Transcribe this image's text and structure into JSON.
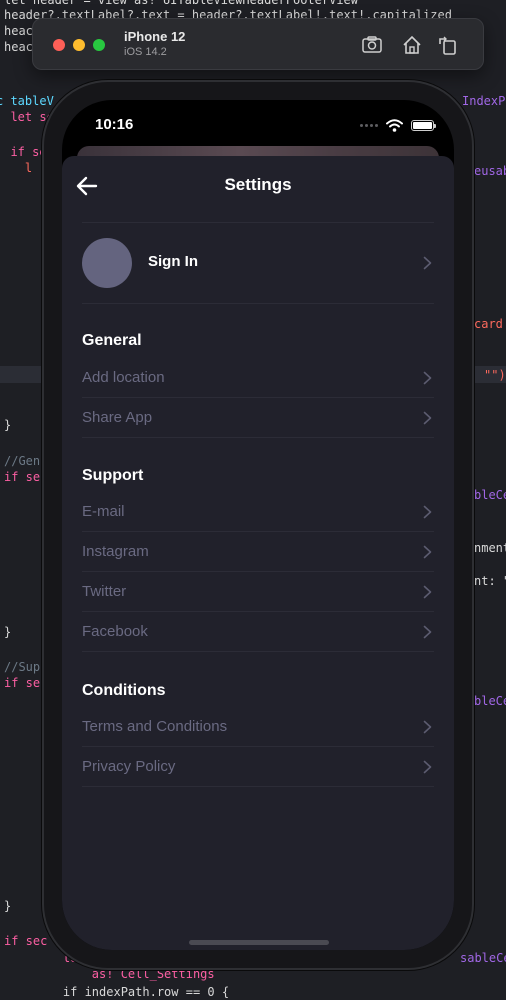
{
  "code": {
    "lines": [
      {
        "text": "let header = view as! UITableViewHeaderFooterView"
      },
      {
        "text": "header?.textLabel?.text = header?.textLabel!.text!.capitalized"
      },
      {
        "text": "heac"
      },
      {
        "text": "heac"
      },
      {
        "text": "c tableV"
      },
      {
        "text": "  let se"
      },
      {
        "text": "  if se"
      },
      {
        "text": "    l"
      },
      {
        "text": "}"
      },
      {
        "text": "//Gen"
      },
      {
        "text": "if se"
      },
      {
        "text": "}"
      },
      {
        "text": "//Sup"
      },
      {
        "text": "if se"
      },
      {
        "text": "}"
      },
      {
        "text": "if sec"
      },
      {
        "text": "    let"
      },
      {
        "text": "        as! Cell_Settings"
      },
      {
        "text": "    if indexPath.row == 0 {"
      }
    ],
    "right_fragments": [
      {
        "text": "IndexP"
      },
      {
        "text": "eusab"
      },
      {
        "text": "card"
      },
      {
        "text": "\"\")"
      },
      {
        "text": "bleCe"
      },
      {
        "text": "nment"
      },
      {
        "text": "nt: \""
      },
      {
        "text": "bleCe"
      },
      {
        "text": "sableCe"
      }
    ]
  },
  "simulator": {
    "device": "iPhone 12",
    "os": "iOS 14.2",
    "icons": [
      "screenshot-icon",
      "home-icon",
      "rotate-icon"
    ]
  },
  "status_bar": {
    "time": "10:16"
  },
  "nav": {
    "title": "Settings",
    "back_icon": "back-arrow-icon"
  },
  "sign_in": {
    "label": "Sign In"
  },
  "sections": [
    {
      "title": "General",
      "items": [
        "Add location",
        "Share App"
      ]
    },
    {
      "title": "Support",
      "items": [
        "E-mail",
        "Instagram",
        "Twitter",
        "Facebook"
      ]
    },
    {
      "title": "Conditions",
      "items": [
        "Terms and Conditions",
        "Privacy Policy"
      ]
    }
  ],
  "colors": {
    "sheet_bg": "#21212b",
    "row_text": "#6a6a82",
    "avatar": "#64647f"
  }
}
